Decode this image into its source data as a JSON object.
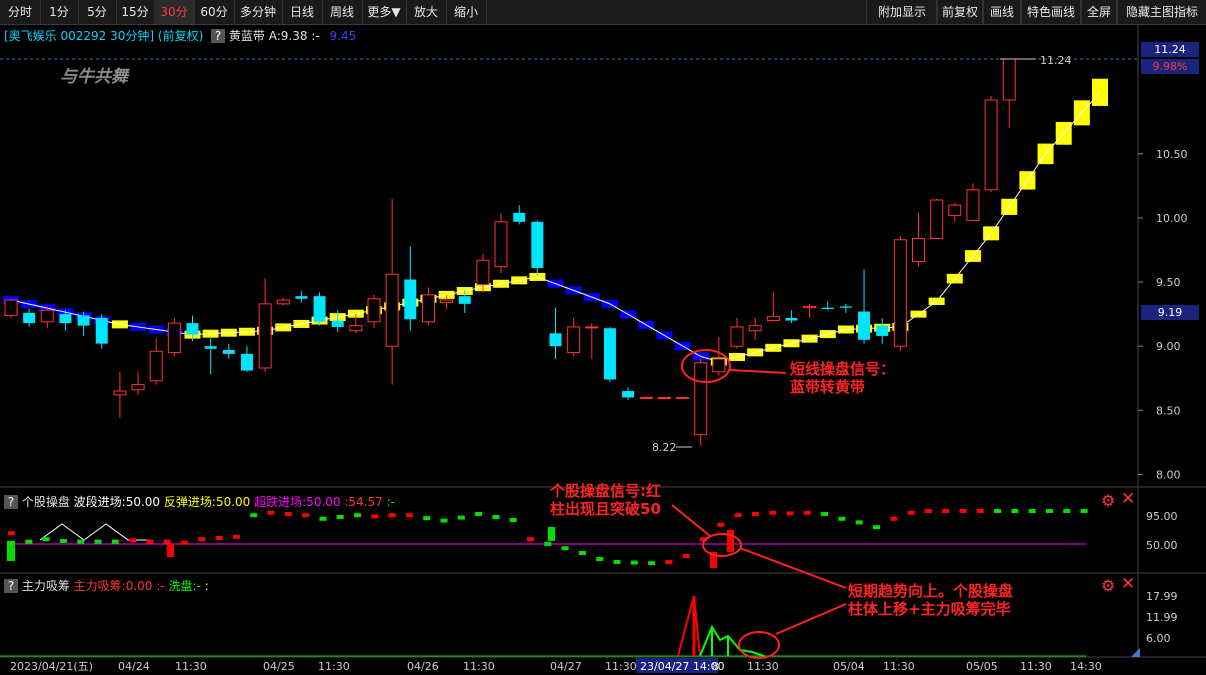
{
  "toolbar": {
    "left": [
      "分时",
      "1分",
      "5分",
      "15分",
      "30分",
      "60分",
      "多分钟",
      "日线",
      "周线",
      "更多▼",
      "放大",
      "缩小"
    ],
    "active_index": 4,
    "right": [
      "附加显示",
      "前复权",
      "画线",
      "特色画线",
      "全屏",
      "隐藏主图指标"
    ]
  },
  "header": {
    "stock": "[奥飞娱乐 002292 30分钟] (前复权)",
    "q": "?",
    "indicator": "黄蓝带 A:9.38",
    "sep": ":-",
    "value": "9.45",
    "logo": "与牛共舞"
  },
  "price_axis": {
    "ticks": [
      "10.50",
      "10.00",
      "9.50",
      "9.00",
      "8.50",
      "8.00"
    ],
    "top_price": "11.24",
    "top_pct": "9.98%",
    "current": "9.19"
  },
  "main_labels": {
    "high": "11.24",
    "low": "8.22"
  },
  "sub1": {
    "q": "?",
    "title": "个股操盘",
    "l1": "波段进场:50.00",
    "l2": "反弹进场:50.00",
    "l3": "超跌进场:50.00",
    "l4": ":54.57",
    "l5": ":-",
    "ticks": [
      "95.00",
      "50.00"
    ]
  },
  "sub2": {
    "q": "?",
    "title": "主力吸筹",
    "l1": "主力吸筹:0.00",
    "l2": ":-",
    "l3": "洗盘:-",
    "l4": ":",
    "ticks": [
      "17.99",
      "11.99",
      "6.00"
    ]
  },
  "date_axis": [
    "2023/04/21(五)",
    "04/24",
    "11:30",
    "04/25",
    "11:30",
    "04/26",
    "11:30",
    "04/27",
    "11:30",
    "23/04/27 14:00",
    "8",
    "11:30",
    "05/04",
    "11:30",
    "05/05",
    "11:30",
    "14:30"
  ],
  "annotations": {
    "a1_line1": "短线操盘信号：",
    "a1_line2": "蓝带转黄带",
    "a2_line1": "个股操盘信号:红",
    "a2_line2": "柱出现且突破50",
    "a3_line1": "短期趋势向上。个股操盘",
    "a3_line2": "柱体上移+主力吸筹完毕"
  },
  "colors": {
    "up": "#ff3333",
    "down": "#00e5ff",
    "band_yellow": "#ffff00",
    "band_blue": "#0000ff",
    "ann": "#ff2222"
  },
  "chart_data": {
    "type": "candlestick",
    "ylim": [
      8.0,
      11.24
    ],
    "candles": [
      [
        9.24,
        9.36,
        9.37,
        9.22
      ],
      [
        9.26,
        9.18,
        9.29,
        9.15
      ],
      [
        9.19,
        9.28,
        9.31,
        9.14
      ],
      [
        9.25,
        9.18,
        9.28,
        9.12
      ],
      [
        9.24,
        9.16,
        9.27,
        9.08
      ],
      [
        9.22,
        9.02,
        9.25,
        8.98
      ],
      [
        8.62,
        8.65,
        8.8,
        8.44
      ],
      [
        8.66,
        8.7,
        8.8,
        8.62
      ],
      [
        8.73,
        8.96,
        9.06,
        8.7
      ],
      [
        8.95,
        9.18,
        9.22,
        8.92
      ],
      [
        9.18,
        9.09,
        9.24,
        9.04
      ],
      [
        9.0,
        8.98,
        9.06,
        8.78
      ],
      [
        8.97,
        8.94,
        9.02,
        8.9
      ],
      [
        8.94,
        8.81,
        9.0,
        8.8
      ],
      [
        8.83,
        9.33,
        9.53,
        8.8
      ],
      [
        9.33,
        9.36,
        9.38,
        9.32
      ],
      [
        9.39,
        9.37,
        9.43,
        9.34
      ],
      [
        9.39,
        9.19,
        9.42,
        9.16
      ],
      [
        9.2,
        9.15,
        9.28,
        9.11
      ],
      [
        9.12,
        9.16,
        9.25,
        9.1
      ],
      [
        9.19,
        9.37,
        9.4,
        9.14
      ],
      [
        9.0,
        9.56,
        10.15,
        8.7
      ],
      [
        9.52,
        9.21,
        9.78,
        9.12
      ],
      [
        9.19,
        9.4,
        9.46,
        9.17
      ],
      [
        9.34,
        9.36,
        9.4,
        9.29
      ],
      [
        9.39,
        9.33,
        9.44,
        9.26
      ],
      [
        9.48,
        9.67,
        9.72,
        9.42
      ],
      [
        9.62,
        9.97,
        10.04,
        9.57
      ],
      [
        10.04,
        9.97,
        10.1,
        9.95
      ],
      [
        9.97,
        9.61,
        9.98,
        9.55
      ],
      [
        9.1,
        9.0,
        9.3,
        8.9
      ],
      [
        8.95,
        9.15,
        9.22,
        8.92
      ],
      [
        9.15,
        9.15,
        9.18,
        8.9
      ],
      [
        9.14,
        8.74,
        9.15,
        8.72
      ],
      [
        8.65,
        8.6,
        8.68,
        8.58
      ],
      [
        8.6,
        8.6,
        8.61,
        8.6
      ],
      [
        8.6,
        8.6,
        8.6,
        8.6
      ],
      [
        8.6,
        8.6,
        8.6,
        8.6
      ],
      [
        8.31,
        8.87,
        8.9,
        8.22
      ],
      [
        8.8,
        8.9,
        9.07,
        8.77
      ],
      [
        9.0,
        9.15,
        9.22,
        8.98
      ],
      [
        9.12,
        9.16,
        9.22,
        9.05
      ],
      [
        9.2,
        9.23,
        9.42,
        9.2
      ],
      [
        9.22,
        9.2,
        9.28,
        9.18
      ],
      [
        9.3,
        9.31,
        9.33,
        9.22
      ],
      [
        9.3,
        9.29,
        9.35,
        9.28
      ],
      [
        9.31,
        9.3,
        9.33,
        9.26
      ],
      [
        9.27,
        9.05,
        9.6,
        9.02
      ],
      [
        9.16,
        9.08,
        9.22,
        9.02
      ],
      [
        9.0,
        9.83,
        9.86,
        8.96
      ],
      [
        9.66,
        9.84,
        10.04,
        9.62
      ],
      [
        9.84,
        10.14,
        10.15,
        9.84
      ],
      [
        10.02,
        10.1,
        10.12,
        9.97
      ],
      [
        9.98,
        10.22,
        10.27,
        9.98
      ],
      [
        10.22,
        10.92,
        10.95,
        10.2
      ],
      [
        10.92,
        11.24,
        11.24,
        10.7
      ]
    ],
    "band_start": 8.98,
    "band_end": 10.4,
    "band_flip_index": 39,
    "sub1_bars": [
      [
        1,
        58
      ],
      [
        0,
        44
      ],
      [
        0,
        48
      ],
      [
        0,
        45
      ],
      [
        0,
        44
      ],
      [
        0,
        44
      ],
      [
        0,
        44
      ],
      [
        1,
        46
      ],
      [
        1,
        44
      ],
      [
        1,
        44
      ],
      [
        1,
        42
      ],
      [
        1,
        48
      ],
      [
        1,
        50
      ],
      [
        1,
        52
      ],
      [
        0,
        88
      ],
      [
        1,
        92
      ],
      [
        1,
        90
      ],
      [
        1,
        88
      ],
      [
        0,
        82
      ],
      [
        0,
        85
      ],
      [
        0,
        88
      ],
      [
        1,
        86
      ],
      [
        1,
        88
      ],
      [
        1,
        88
      ],
      [
        0,
        83
      ],
      [
        0,
        79
      ],
      [
        0,
        84
      ],
      [
        0,
        90
      ],
      [
        0,
        85
      ],
      [
        0,
        80
      ],
      [
        1,
        48
      ],
      [
        0,
        40
      ],
      [
        0,
        33
      ],
      [
        0,
        25
      ],
      [
        0,
        15
      ],
      [
        0,
        10
      ],
      [
        0,
        9
      ],
      [
        0,
        8
      ],
      [
        1,
        10
      ],
      [
        1,
        20
      ],
      [
        1,
        48
      ],
      [
        1,
        72
      ],
      [
        1,
        88
      ],
      [
        1,
        90
      ],
      [
        1,
        92
      ],
      [
        1,
        91
      ],
      [
        1,
        92
      ],
      [
        0,
        90
      ],
      [
        0,
        82
      ],
      [
        0,
        76
      ],
      [
        0,
        68
      ],
      [
        1,
        82
      ],
      [
        1,
        92
      ],
      [
        1,
        95
      ],
      [
        1,
        95
      ],
      [
        1,
        95
      ],
      [
        1,
        95
      ],
      [
        0,
        95
      ],
      [
        0,
        95
      ],
      [
        0,
        95
      ],
      [
        0,
        95
      ],
      [
        0,
        95
      ],
      [
        0,
        95
      ]
    ],
    "sub1_ylim": [
      0,
      120
    ],
    "sub2_zero": 0,
    "sub2_ylim": [
      0,
      20
    ]
  }
}
